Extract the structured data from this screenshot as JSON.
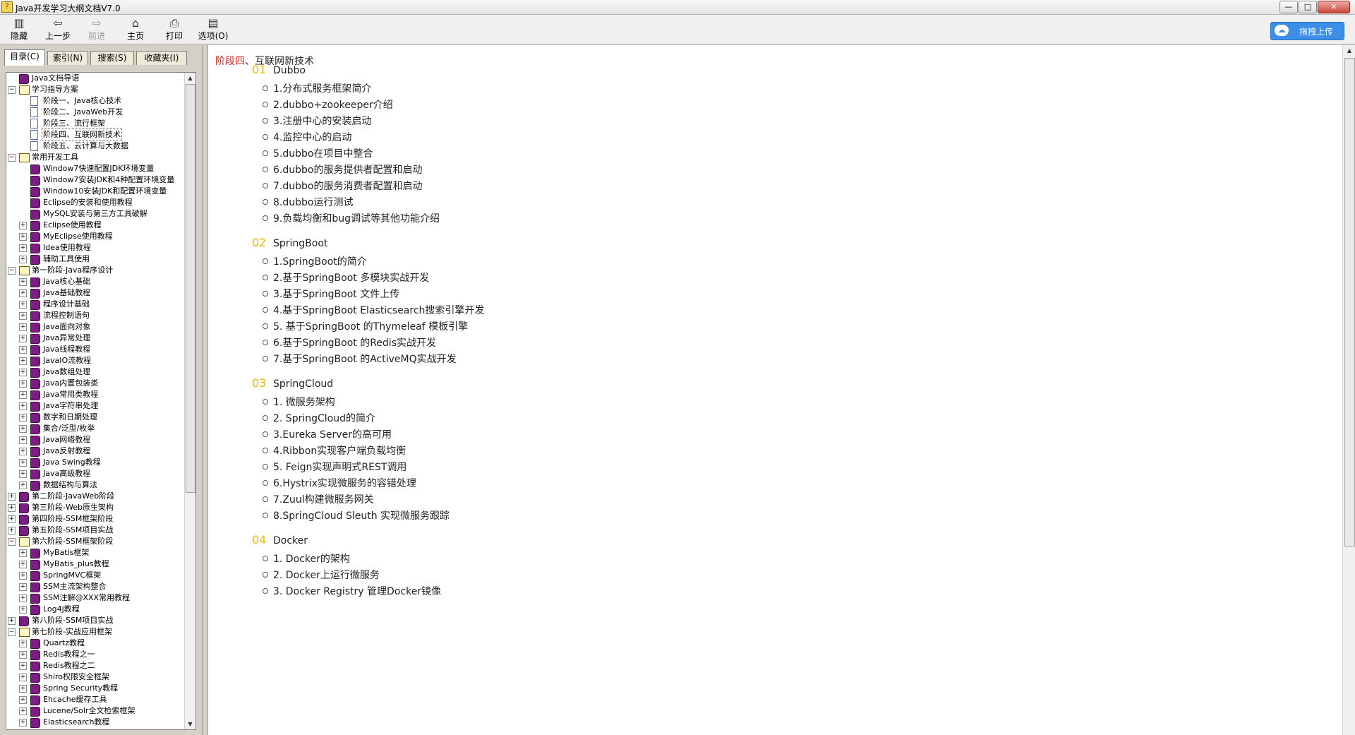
{
  "window": {
    "title": "Java开发学习大纲文档V7.0",
    "min_glyph": "—",
    "max_glyph": "□",
    "close_glyph": "✕"
  },
  "toolbar": {
    "hide_label": "隐藏",
    "back_label": "上一步",
    "forward_label": "前进",
    "home_label": "主页",
    "print_label": "打印",
    "options_label": "选项(O)",
    "upload_label": "拖拽上传"
  },
  "tabs": [
    "目录(C)",
    "索引(N)",
    "搜索(S)",
    "收藏夹(I)"
  ],
  "tree": [
    {
      "label": "Java文档导语",
      "level": 0,
      "expander": "",
      "icon": "book-icon"
    },
    {
      "label": "学习指导方案",
      "level": 0,
      "expander": "−",
      "icon": "book-open-icon"
    },
    {
      "label": "阶段一、Java核心技术",
      "level": 1,
      "expander": "",
      "icon": "page-icon"
    },
    {
      "label": "阶段二、JavaWeb开发",
      "level": 1,
      "expander": "",
      "icon": "page-icon"
    },
    {
      "label": "阶段三、流行框架",
      "level": 1,
      "expander": "",
      "icon": "page-icon"
    },
    {
      "label": "阶段四、互联网新技术",
      "level": 1,
      "expander": "",
      "icon": "page-icon",
      "selected": true
    },
    {
      "label": "阶段五、云计算与大数据",
      "level": 1,
      "expander": "",
      "icon": "page-icon"
    },
    {
      "label": "常用开发工具",
      "level": 0,
      "expander": "−",
      "icon": "book-open-icon"
    },
    {
      "label": "Window7快速配置JDK环境变量",
      "level": 1,
      "expander": "",
      "icon": "book-icon"
    },
    {
      "label": "Window7安装JDK和4种配置环境变量",
      "level": 1,
      "expander": "",
      "icon": "book-icon"
    },
    {
      "label": "Window10安装JDK和配置环境变量",
      "level": 1,
      "expander": "",
      "icon": "book-icon"
    },
    {
      "label": "Eclipse的安装和使用教程",
      "level": 1,
      "expander": "",
      "icon": "book-icon"
    },
    {
      "label": "MySQL安装与第三方工具破解",
      "level": 1,
      "expander": "",
      "icon": "book-icon"
    },
    {
      "label": "Eclipse使用教程",
      "level": 1,
      "expander": "+",
      "icon": "book-icon"
    },
    {
      "label": "MyEclipse使用教程",
      "level": 1,
      "expander": "+",
      "icon": "book-icon"
    },
    {
      "label": "Idea使用教程",
      "level": 1,
      "expander": "+",
      "icon": "book-icon"
    },
    {
      "label": "辅助工具使用",
      "level": 1,
      "expander": "+",
      "icon": "book-icon"
    },
    {
      "label": "第一阶段-Java程序设计",
      "level": 0,
      "expander": "−",
      "icon": "book-open-icon"
    },
    {
      "label": "Java核心基础",
      "level": 1,
      "expander": "+",
      "icon": "book-icon"
    },
    {
      "label": "Java基础教程",
      "level": 1,
      "expander": "+",
      "icon": "book-icon"
    },
    {
      "label": "程序设计基础",
      "level": 1,
      "expander": "+",
      "icon": "book-icon"
    },
    {
      "label": "流程控制语句",
      "level": 1,
      "expander": "+",
      "icon": "book-icon"
    },
    {
      "label": "Java面向对象",
      "level": 1,
      "expander": "+",
      "icon": "book-icon"
    },
    {
      "label": "Java异常处理",
      "level": 1,
      "expander": "+",
      "icon": "book-icon"
    },
    {
      "label": "Java线程教程",
      "level": 1,
      "expander": "+",
      "icon": "book-icon"
    },
    {
      "label": "JavaIO流教程",
      "level": 1,
      "expander": "+",
      "icon": "book-icon"
    },
    {
      "label": "Java数组处理",
      "level": 1,
      "expander": "+",
      "icon": "book-icon"
    },
    {
      "label": "Java内置包装类",
      "level": 1,
      "expander": "+",
      "icon": "book-icon"
    },
    {
      "label": "Java常用类教程",
      "level": 1,
      "expander": "+",
      "icon": "book-icon"
    },
    {
      "label": "Java字符串处理",
      "level": 1,
      "expander": "+",
      "icon": "book-icon"
    },
    {
      "label": "数字和日期处理",
      "level": 1,
      "expander": "+",
      "icon": "book-icon"
    },
    {
      "label": "集合/泛型/枚举",
      "level": 1,
      "expander": "+",
      "icon": "book-icon"
    },
    {
      "label": "Java网络教程",
      "level": 1,
      "expander": "+",
      "icon": "book-icon"
    },
    {
      "label": "Java反射教程",
      "level": 1,
      "expander": "+",
      "icon": "book-icon"
    },
    {
      "label": "Java Swing教程",
      "level": 1,
      "expander": "+",
      "icon": "book-icon"
    },
    {
      "label": "Java高级教程",
      "level": 1,
      "expander": "+",
      "icon": "book-icon"
    },
    {
      "label": "数据结构与算法",
      "level": 1,
      "expander": "+",
      "icon": "book-icon"
    },
    {
      "label": "第二阶段-JavaWeb阶段",
      "level": 0,
      "expander": "+",
      "icon": "book-icon"
    },
    {
      "label": "第三阶段-Web原生架构",
      "level": 0,
      "expander": "+",
      "icon": "book-icon"
    },
    {
      "label": "第四阶段-SSM框架阶段",
      "level": 0,
      "expander": "+",
      "icon": "book-icon"
    },
    {
      "label": "第五阶段-SSM项目实战",
      "level": 0,
      "expander": "+",
      "icon": "book-icon"
    },
    {
      "label": "第六阶段-SSM框架阶段",
      "level": 0,
      "expander": "−",
      "icon": "book-open-icon"
    },
    {
      "label": "MyBatis框架",
      "level": 1,
      "expander": "+",
      "icon": "book-icon"
    },
    {
      "label": "MyBatis_plus教程",
      "level": 1,
      "expander": "+",
      "icon": "book-icon"
    },
    {
      "label": "SpringMVC框架",
      "level": 1,
      "expander": "+",
      "icon": "book-icon"
    },
    {
      "label": "SSM主流架构整合",
      "level": 1,
      "expander": "+",
      "icon": "book-icon"
    },
    {
      "label": "SSM注解@XXX常用教程",
      "level": 1,
      "expander": "+",
      "icon": "book-icon"
    },
    {
      "label": "Log4j教程",
      "level": 1,
      "expander": "+",
      "icon": "book-icon"
    },
    {
      "label": "第八阶段-SSM项目实战",
      "level": 0,
      "expander": "+",
      "icon": "book-icon"
    },
    {
      "label": "第七阶段-实战应用框架",
      "level": 0,
      "expander": "−",
      "icon": "book-open-icon"
    },
    {
      "label": "Quartz教程",
      "level": 1,
      "expander": "+",
      "icon": "book-icon"
    },
    {
      "label": "Redis教程之一",
      "level": 1,
      "expander": "+",
      "icon": "book-icon"
    },
    {
      "label": "Redis教程之二",
      "level": 1,
      "expander": "+",
      "icon": "book-icon"
    },
    {
      "label": "Shiro权限安全框架",
      "level": 1,
      "expander": "+",
      "icon": "book-icon"
    },
    {
      "label": "Spring Security教程",
      "level": 1,
      "expander": "+",
      "icon": "book-icon"
    },
    {
      "label": "Ehcache缓存工具",
      "level": 1,
      "expander": "+",
      "icon": "book-icon"
    },
    {
      "label": "Lucene/Solr全文检索框架",
      "level": 1,
      "expander": "+",
      "icon": "book-icon"
    },
    {
      "label": "Elasticsearch教程",
      "level": 1,
      "expander": "+",
      "icon": "book-icon"
    }
  ],
  "content": {
    "breadcrumb_stage": "阶段四",
    "breadcrumb_rest": "、互联网新技术",
    "sections": [
      {
        "num": "01",
        "title": "Dubbo",
        "items": [
          "1.分布式服务框架简介",
          "2.dubbo+zookeeper介绍",
          "3.注册中心的安装启动",
          "4.监控中心的启动",
          "5.dubbo在项目中整合",
          "6.dubbo的服务提供者配置和启动",
          "7.dubbo的服务消费者配置和启动",
          "8.dubbo运行测试",
          "9.负载均衡和bug调试等其他功能介绍"
        ]
      },
      {
        "num": "02",
        "title": "SpringBoot",
        "items": [
          "1.SpringBoot的简介",
          "2.基于SpringBoot 多模块实战开发",
          "3.基于SpringBoot 文件上传",
          "4.基于SpringBoot Elasticsearch搜索引擎开发",
          "5. 基于SpringBoot 的Thymeleaf 模板引擎",
          "6.基于SpringBoot 的Redis实战开发",
          "7.基于SpringBoot 的ActiveMQ实战开发"
        ]
      },
      {
        "num": "03",
        "title": "SpringCloud",
        "items": [
          "1. 微服务架构",
          "2. SpringCloud的简介",
          "3.Eureka Server的高可用",
          "4.Ribbon实现客户端负载均衡",
          "5. Feign实现声明式REST调用",
          "6.Hystrix实现微服务的容错处理",
          "7.Zuul构建微服务网关",
          "8.SpringCloud Sleuth 实现微服务跟踪"
        ]
      },
      {
        "num": "04",
        "title": "Docker",
        "items": [
          "1. Docker的架构",
          "2. Docker上运行微服务",
          "3. Docker Registry 管理Docker镜像"
        ]
      }
    ]
  }
}
